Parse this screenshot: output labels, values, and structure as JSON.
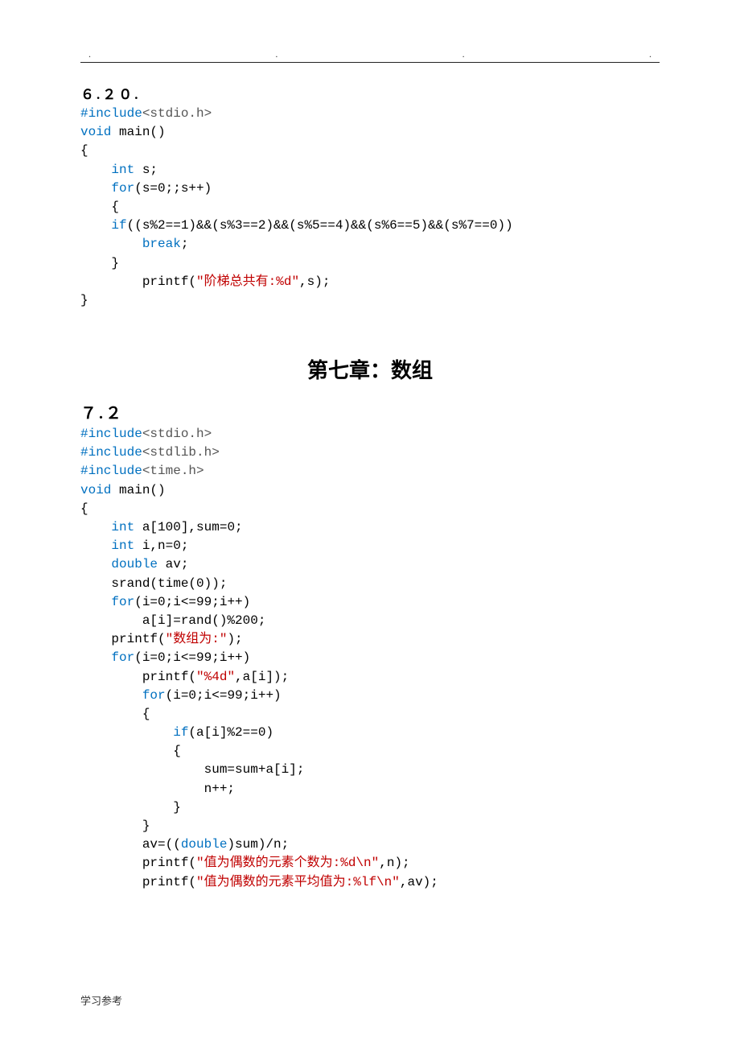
{
  "header": {
    "dot": "."
  },
  "section_620": "６.２０.",
  "code_620": [
    {
      "cls": "c-pre",
      "t": "#include"
    },
    {
      "cls": "c-hdr",
      "t": "<stdio.h>"
    },
    {
      "t": "\n"
    },
    {
      "cls": "c-kw",
      "t": "void"
    },
    {
      "t": " main()\n"
    },
    {
      "t": "{\n"
    },
    {
      "t": "    "
    },
    {
      "cls": "c-kw",
      "t": "int"
    },
    {
      "t": " s;\n"
    },
    {
      "t": "    "
    },
    {
      "cls": "c-kw",
      "t": "for"
    },
    {
      "t": "(s=0;;s++)\n"
    },
    {
      "t": "    {\n"
    },
    {
      "t": "    "
    },
    {
      "cls": "c-kw",
      "t": "if"
    },
    {
      "t": "((s%2==1)&&(s%3==2)&&(s%5==4)&&(s%6==5)&&(s%7==0))\n"
    },
    {
      "t": "        "
    },
    {
      "cls": "c-kw",
      "t": "break"
    },
    {
      "t": ";\n"
    },
    {
      "t": "    }\n"
    },
    {
      "t": "        printf("
    },
    {
      "cls": "c-str",
      "t": "\"阶梯总共有:%d\""
    },
    {
      "t": ",s);\n"
    },
    {
      "t": "}\n"
    }
  ],
  "chapter_title": "第七章：数组",
  "section_72": "７.２",
  "code_72": [
    {
      "cls": "c-pre",
      "t": "#include"
    },
    {
      "cls": "c-hdr",
      "t": "<stdio.h>"
    },
    {
      "t": "\n"
    },
    {
      "cls": "c-pre",
      "t": "#include"
    },
    {
      "cls": "c-hdr",
      "t": "<stdlib.h>"
    },
    {
      "t": "\n"
    },
    {
      "cls": "c-pre",
      "t": "#include"
    },
    {
      "cls": "c-hdr",
      "t": "<time.h>"
    },
    {
      "t": "\n"
    },
    {
      "cls": "c-kw",
      "t": "void"
    },
    {
      "t": " main()\n"
    },
    {
      "t": "{\n"
    },
    {
      "t": "    "
    },
    {
      "cls": "c-kw",
      "t": "int"
    },
    {
      "t": " a[100],sum=0;\n"
    },
    {
      "t": "    "
    },
    {
      "cls": "c-kw",
      "t": "int"
    },
    {
      "t": " i,n=0;\n"
    },
    {
      "t": "    "
    },
    {
      "cls": "c-kw",
      "t": "double"
    },
    {
      "t": " av;\n"
    },
    {
      "t": "    srand(time(0));\n"
    },
    {
      "t": "    "
    },
    {
      "cls": "c-kw",
      "t": "for"
    },
    {
      "t": "(i=0;i<=99;i++)\n"
    },
    {
      "t": "        a[i]=rand()%200;\n"
    },
    {
      "t": "    printf("
    },
    {
      "cls": "c-str",
      "t": "\"数组为:\""
    },
    {
      "t": ");\n"
    },
    {
      "t": "    "
    },
    {
      "cls": "c-kw",
      "t": "for"
    },
    {
      "t": "(i=0;i<=99;i++)\n"
    },
    {
      "t": "        printf("
    },
    {
      "cls": "c-str",
      "t": "\"%4d\""
    },
    {
      "t": ",a[i]);\n"
    },
    {
      "t": "        "
    },
    {
      "cls": "c-kw",
      "t": "for"
    },
    {
      "t": "(i=0;i<=99;i++)\n"
    },
    {
      "t": "        {\n"
    },
    {
      "t": "            "
    },
    {
      "cls": "c-kw",
      "t": "if"
    },
    {
      "t": "(a[i]%2==0)\n"
    },
    {
      "t": "            {\n"
    },
    {
      "t": "                sum=sum+a[i];\n"
    },
    {
      "t": "                n++;\n"
    },
    {
      "t": "            }\n"
    },
    {
      "t": "        }\n"
    },
    {
      "t": "        av=(("
    },
    {
      "cls": "c-kw",
      "t": "double"
    },
    {
      "t": ")sum)/n;\n"
    },
    {
      "t": "        printf("
    },
    {
      "cls": "c-str",
      "t": "\"值为偶数的元素个数为:%d\\n\""
    },
    {
      "t": ",n);\n"
    },
    {
      "t": "        printf("
    },
    {
      "cls": "c-str",
      "t": "\"值为偶数的元素平均值为:%lf\\n\""
    },
    {
      "t": ",av);\n"
    }
  ],
  "footer": "学习参考"
}
